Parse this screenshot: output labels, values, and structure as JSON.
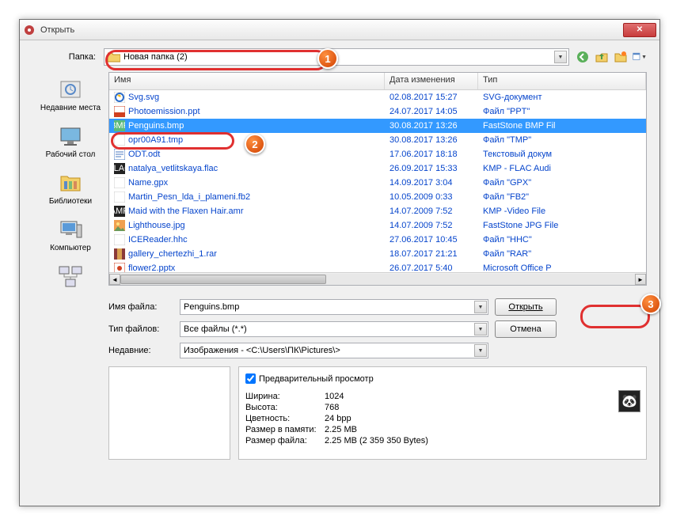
{
  "title": "Открыть",
  "folder_label": "Папка:",
  "folder_value": "Новая папка (2)",
  "badges": {
    "b1": "1",
    "b2": "2",
    "b3": "3"
  },
  "places": [
    {
      "label": "Недавние места"
    },
    {
      "label": "Рабочий стол"
    },
    {
      "label": "Библиотеки"
    },
    {
      "label": "Компьютер"
    }
  ],
  "columns": {
    "name": "Имя",
    "date": "Дата изменения",
    "type": "Тип"
  },
  "files": [
    {
      "name": "Svg.svg",
      "date": "02.08.2017 15:27",
      "type": "SVG-документ",
      "ico": "ie"
    },
    {
      "name": "Photoemission.ppt",
      "date": "24.07.2017 14:05",
      "type": "Файл \"PPT\"",
      "ico": "ppt"
    },
    {
      "name": "Penguins.bmp",
      "date": "30.08.2017 13:26",
      "type": "FastStone BMP Fil",
      "ico": "bmp",
      "sel": true
    },
    {
      "name": "opr00A91.tmp",
      "date": "30.08.2017 13:26",
      "type": "Файл \"TMP\"",
      "ico": "blank"
    },
    {
      "name": "ODT.odt",
      "date": "17.06.2017 18:18",
      "type": "Текстовый докум",
      "ico": "doc"
    },
    {
      "name": "natalya_vetlitskaya.flac",
      "date": "26.09.2017 15:33",
      "type": "KMP - FLAC Audi",
      "ico": "flac"
    },
    {
      "name": "Name.gpx",
      "date": "14.09.2017 3:04",
      "type": "Файл \"GPX\"",
      "ico": "blank"
    },
    {
      "name": "Martin_Pesn_lda_i_plameni.fb2",
      "date": "10.05.2009 0:33",
      "type": "Файл \"FB2\"",
      "ico": "blank"
    },
    {
      "name": "Maid with the Flaxen Hair.amr",
      "date": "14.07.2009 7:52",
      "type": "KMP -Video File",
      "ico": "amr"
    },
    {
      "name": "Lighthouse.jpg",
      "date": "14.07.2009 7:52",
      "type": "FastStone JPG File",
      "ico": "jpg"
    },
    {
      "name": "ICEReader.hhc",
      "date": "27.06.2017 10:45",
      "type": "Файл \"HHC\"",
      "ico": "blank"
    },
    {
      "name": "gallery_chertezhi_1.rar",
      "date": "18.07.2017 21:21",
      "type": "Файл \"RAR\"",
      "ico": "rar"
    },
    {
      "name": "flower2.pptx",
      "date": "26.07.2017 5:40",
      "type": "Microsoft Office P",
      "ico": "pptx"
    }
  ],
  "filename_label": "Имя файла:",
  "filename_value": "Penguins.bmp",
  "filetype_label": "Тип файлов:",
  "filetype_value": "Все файлы (*.*)",
  "recent_label": "Недавние:",
  "recent_value": "Изображения  -  <C:\\Users\\ПК\\Pictures\\>",
  "open_btn": "Открыть",
  "cancel_btn": "Отмена",
  "preview_check": "Предварительный просмотр",
  "info": {
    "width_lbl": "Ширина:",
    "width_val": "1024",
    "height_lbl": "Высота:",
    "height_val": "768",
    "depth_lbl": "Цветность:",
    "depth_val": "24 bpp",
    "mem_lbl": "Размер в памяти:",
    "mem_val": "2.25 MB",
    "size_lbl": "Размер файла:",
    "size_val": "2.25 MB (2 359 350 Bytes)"
  }
}
